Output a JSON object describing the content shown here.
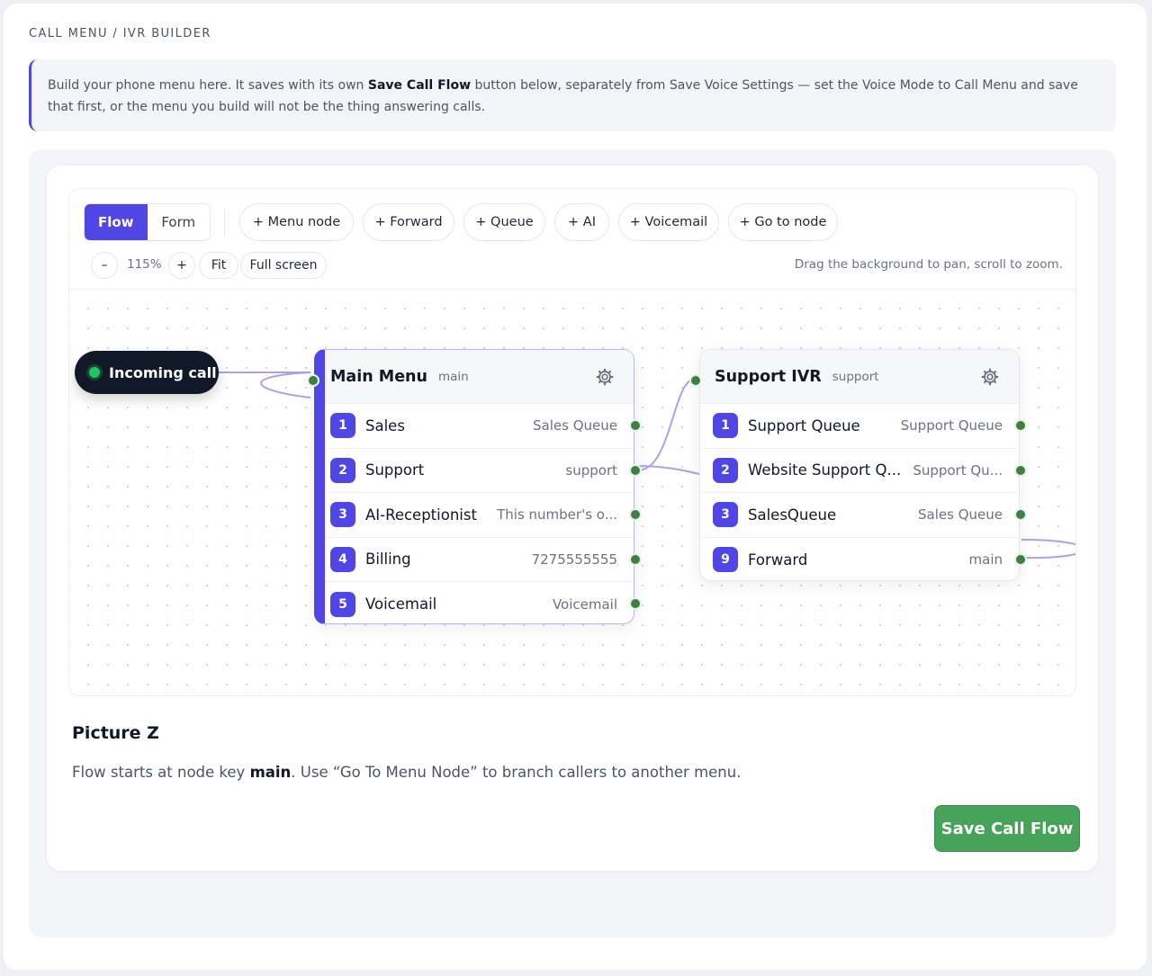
{
  "section_title": "CALL MENU / IVR BUILDER",
  "notice": {
    "before": "Build your phone menu here. It saves with its own ",
    "bold": "Save Call Flow",
    "after": " button below, separately from Save Voice Settings — set the Voice Mode to Call Menu and save that first, or the menu you build will not be the thing answering calls."
  },
  "toolbar": {
    "view_modes": [
      "Flow",
      "Form"
    ],
    "active_view": "Flow",
    "add_buttons": [
      "+ Menu node",
      "+ Forward",
      "+ Queue",
      "+ AI",
      "+ Voicemail",
      "+ Go to node"
    ],
    "zoom_out": "–",
    "zoom_level": "115%",
    "zoom_in": "+",
    "fit": "Fit",
    "full_screen": "Full screen",
    "hint": "Drag the background to pan, scroll to zoom."
  },
  "canvas": {
    "incoming_label": "Incoming call",
    "nodes": {
      "main": {
        "title": "Main Menu",
        "key": "main",
        "rows": [
          {
            "digit": "1",
            "label": "Sales",
            "target": "Sales Queue"
          },
          {
            "digit": "2",
            "label": "Support",
            "target": "support"
          },
          {
            "digit": "3",
            "label": "AI-Receptionist",
            "target": "This number's o..."
          },
          {
            "digit": "4",
            "label": "Billing",
            "target": "7275555555"
          },
          {
            "digit": "5",
            "label": "Voicemail",
            "target": "Voicemail"
          }
        ]
      },
      "support": {
        "title": "Support IVR",
        "key": "support",
        "rows": [
          {
            "digit": "1",
            "label": "Support Queue",
            "target": "Support Queue"
          },
          {
            "digit": "2",
            "label": "Website Support Q...",
            "target": "Support Qu..."
          },
          {
            "digit": "3",
            "label": "SalesQueue",
            "target": "Sales Queue"
          },
          {
            "digit": "9",
            "label": "Forward",
            "target": "main"
          }
        ]
      }
    }
  },
  "picture": {
    "title": "Picture Z",
    "desc_before": "Flow starts at node key ",
    "desc_bold": "main",
    "desc_after": ". Use “Go To Menu Node” to branch callers to another menu."
  },
  "save_button": "Save Call Flow",
  "colors": {
    "accent": "#4f46e5",
    "port": "#3f7f44",
    "save": "#47a25a",
    "wire": "#a8a2f0"
  }
}
